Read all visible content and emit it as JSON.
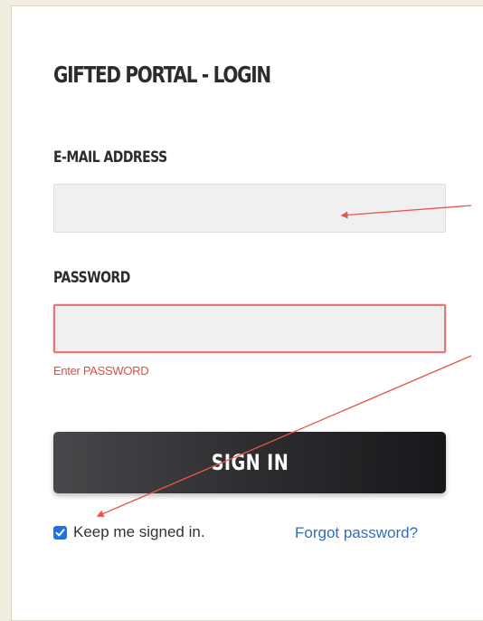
{
  "title": "GIFTED PORTAL - LOGIN",
  "email": {
    "label": "E-MAIL ADDRESS",
    "value": "",
    "placeholder": ""
  },
  "password": {
    "label": "PASSWORD",
    "value": "",
    "placeholder": "",
    "error": "Enter PASSWORD"
  },
  "signin_label": "SIGN IN",
  "remember": {
    "label": "Keep me signed in.",
    "checked": true
  },
  "forgot_label": "Forgot password?",
  "colors": {
    "background": "#f2ede1",
    "error": "#e04c46",
    "link": "#2f6fbd",
    "checkbox": "#1a73e8",
    "annotation_arrow": "#e8564a"
  },
  "icons": {
    "checkbox": "check-icon",
    "annotations": "arrow-icon"
  }
}
